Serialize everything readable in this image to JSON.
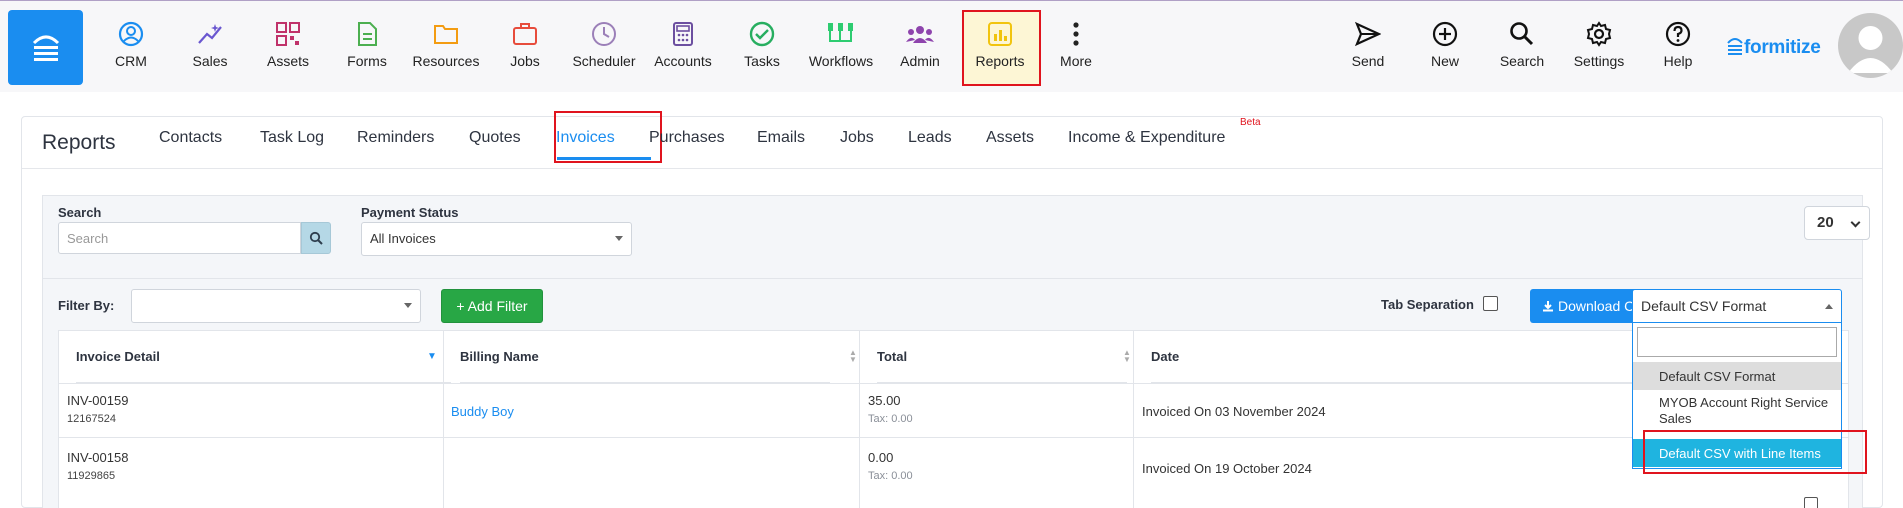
{
  "nav": {
    "items": [
      {
        "label": "CRM",
        "icon": "crm-icon",
        "color": "#1a8df0"
      },
      {
        "label": "Sales",
        "icon": "sales-icon",
        "color": "#6a57d0"
      },
      {
        "label": "Assets",
        "icon": "assets-icon",
        "color": "#c0326a"
      },
      {
        "label": "Forms",
        "icon": "forms-icon",
        "color": "#4caf50"
      },
      {
        "label": "Resources",
        "icon": "resources-icon",
        "color": "#f39c12"
      },
      {
        "label": "Jobs",
        "icon": "jobs-icon",
        "color": "#e74c3c"
      },
      {
        "label": "Scheduler",
        "icon": "scheduler-icon",
        "color": "#9b7fb8"
      },
      {
        "label": "Accounts",
        "icon": "accounts-icon",
        "color": "#6c4fa0"
      },
      {
        "label": "Tasks",
        "icon": "tasks-icon",
        "color": "#27ae60"
      },
      {
        "label": "Workflows",
        "icon": "workflows-icon",
        "color": "#2ecc71"
      },
      {
        "label": "Admin",
        "icon": "admin-icon",
        "color": "#8e44ad"
      },
      {
        "label": "Reports",
        "icon": "reports-icon",
        "color": "#f1c40f"
      },
      {
        "label": "More",
        "icon": "more-icon",
        "color": "#222"
      }
    ],
    "right_items": [
      {
        "label": "Send",
        "icon": "send-icon"
      },
      {
        "label": "New",
        "icon": "plus-circle-icon"
      },
      {
        "label": "Search",
        "icon": "search-icon"
      },
      {
        "label": "Settings",
        "icon": "gear-icon"
      },
      {
        "label": "Help",
        "icon": "help-icon"
      }
    ],
    "brand": "formitize",
    "accent_color": "#1a8df0"
  },
  "reports": {
    "title": "Reports",
    "tabs": [
      "Contacts",
      "Task Log",
      "Reminders",
      "Quotes",
      "Invoices",
      "Purchases",
      "Emails",
      "Jobs",
      "Leads",
      "Assets",
      "Income & Expenditure"
    ],
    "active_tab": "Invoices",
    "beta_label": "Beta"
  },
  "filters": {
    "search_label": "Search",
    "search_placeholder": "Search",
    "payment_status_label": "Payment Status",
    "payment_status_value": "All Invoices",
    "per_page": "20",
    "filter_by_label": "Filter By:",
    "add_filter_label": "+ Add Filter",
    "tab_separation_label": "Tab Separation",
    "download_csv_label": "Download CSV",
    "csv_format_value": "Default CSV Format",
    "csv_options": [
      "Default CSV Format",
      "MYOB Account Right Service Sales",
      "Default CSV with Line Items"
    ],
    "csv_selected": "Default CSV Format",
    "csv_highlighted": "Default CSV with Line Items"
  },
  "table": {
    "columns": [
      "Invoice Detail",
      "Billing Name",
      "Total",
      "Date"
    ],
    "rows": [
      {
        "invoice": "INV-00159",
        "number": "12167524",
        "billing_name": "Buddy Boy",
        "total": "35.00",
        "tax": "Tax: 0.00",
        "date": "Invoiced On 03 November 2024"
      },
      {
        "invoice": "INV-00158",
        "number": "11929865",
        "billing_name": "",
        "total": "0.00",
        "tax": "Tax: 0.00",
        "date": "Invoiced On 19 October 2024"
      }
    ]
  }
}
